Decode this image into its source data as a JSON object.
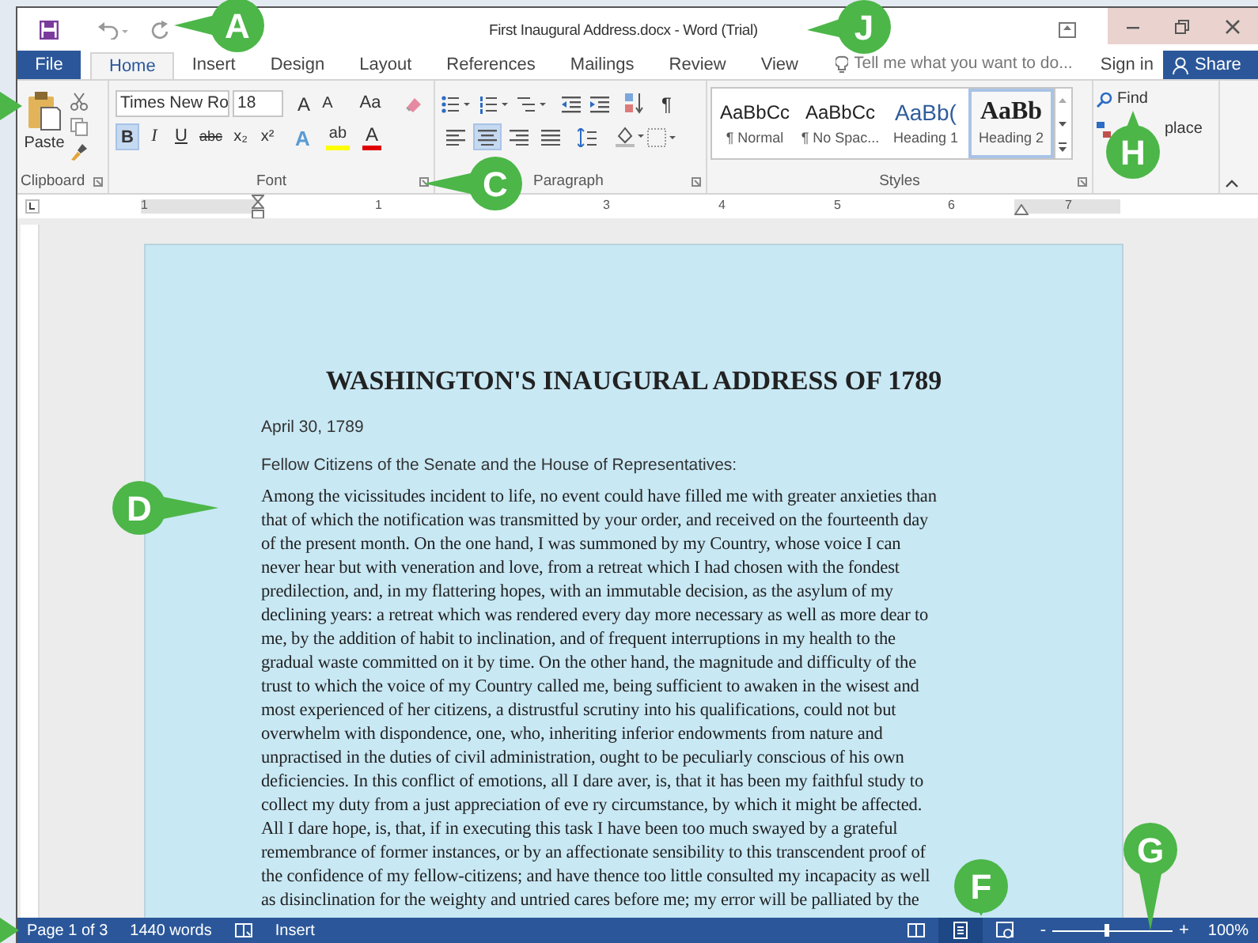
{
  "title_bar": {
    "title": "First Inaugural Address.docx - Word (Trial)"
  },
  "tabs": [
    {
      "label": "File",
      "kind": "file",
      "selected": false
    },
    {
      "label": "Home",
      "kind": "tab",
      "selected": true
    },
    {
      "label": "Insert",
      "kind": "tab",
      "selected": false
    },
    {
      "label": "Design",
      "kind": "tab",
      "selected": false
    },
    {
      "label": "Layout",
      "kind": "tab",
      "selected": false
    },
    {
      "label": "References",
      "kind": "tab",
      "selected": false
    },
    {
      "label": "Mailings",
      "kind": "tab",
      "selected": false
    },
    {
      "label": "Review",
      "kind": "tab",
      "selected": false
    },
    {
      "label": "View",
      "kind": "tab",
      "selected": false
    }
  ],
  "tell_me": {
    "placeholder": "Tell me what you want to do..."
  },
  "account": {
    "sign_in": "Sign in",
    "share": "Share"
  },
  "ribbon": {
    "clipboard": {
      "paste": "Paste",
      "label": "Clipboard"
    },
    "font": {
      "font_name": "Times New Ro",
      "font_size": "18",
      "grow": "A",
      "shrink": "A",
      "change_case": "Aa",
      "label": "Font",
      "format_buttons": [
        {
          "label": "B",
          "kind": "bold",
          "selected": true
        },
        {
          "label": "I",
          "kind": "italic",
          "selected": false
        },
        {
          "label": "U",
          "kind": "underline",
          "selected": false
        },
        {
          "label": "abc",
          "kind": "strike",
          "selected": false
        },
        {
          "label": "x₂",
          "kind": "plain",
          "selected": false
        },
        {
          "label": "x²",
          "kind": "plain",
          "selected": false
        }
      ],
      "effect_buttons": [
        {
          "label": "A",
          "kind": "effects"
        },
        {
          "label": "ab",
          "kind": "highlight",
          "color": "#ffff00"
        },
        {
          "label": "A",
          "kind": "font_color",
          "color": "#e00000"
        }
      ]
    },
    "paragraph": {
      "pilcrow": "¶",
      "label": "Paragraph",
      "alignments": [
        {
          "kind": "left",
          "selected": false
        },
        {
          "kind": "center",
          "selected": true
        },
        {
          "kind": "right",
          "selected": false
        },
        {
          "kind": "justify",
          "selected": false
        }
      ]
    },
    "styles": {
      "label": "Styles",
      "items": [
        {
          "preview": "AaBbCc",
          "name": "¶ Normal",
          "kind": "normal",
          "selected": false
        },
        {
          "preview": "AaBbCc",
          "name": "¶ No Spac...",
          "kind": "normal",
          "selected": false
        },
        {
          "preview": "AaBb(",
          "name": "Heading 1",
          "kind": "heading1",
          "selected": false
        },
        {
          "preview": "AaBb",
          "name": "Heading 2",
          "kind": "heading2",
          "selected": true
        }
      ]
    },
    "editing": {
      "find": "Find",
      "replace": "place"
    }
  },
  "ruler": {
    "marks": [
      "1",
      "1",
      "3",
      "4",
      "5",
      "6",
      "7"
    ]
  },
  "document": {
    "heading": "WASHINGTON'S INAUGURAL ADDRESS OF 1789",
    "date": "April 30, 1789",
    "salutation": "Fellow Citizens of the Senate and the House of Representatives:",
    "body_lines": [
      "Among the vicissitudes incident to life, no event could have filled me with greater anxieties than",
      "that of which the notification was transmitted by your order, and received on the fourteenth day",
      "of the present month. On the one hand, I was summoned by my Country, whose voice I can",
      "never hear but with veneration and love, from a retreat which I had chosen with the fondest",
      "predilection, and, in my flattering hopes, with an immutable decision, as the asylum of my",
      "declining years: a retreat which was rendered every day more necessary as well as more dear to",
      "me, by the addition of habit to inclination, and of frequent interruptions in my health to the",
      "gradual waste committed on it by time. On the other hand, the magnitude and difficulty of the",
      "trust to which the voice of my Country called me, being sufficient to awaken in the wisest and",
      "most experienced of her citizens, a distrustful scrutiny into his qualifications, could not but",
      "overwhelm with dispondence, one, who, inheriting inferior endowments from nature and",
      "unpractised in the duties of civil administration, ought to be peculiarly conscious of his own",
      "deficiencies. In this conflict of emotions, all I dare aver, is, that it has been my faithful study to",
      "collect my duty from a just appreciation of eve ry circumstance, by which it might be affected.",
      "All I dare hope, is, that, if in executing this task I have been too much swayed by a grateful",
      "remembrance of former instances, or by an affectionate sensibility to this transcendent proof of",
      "the confidence of my fellow-citizens; and have thence too little consulted my incapacity as well",
      "as disinclination for the weighty and untried cares before me; my error will be palliated by the"
    ]
  },
  "status_bar": {
    "page": "Page 1 of 3",
    "words": "1440 words",
    "mode": "Insert",
    "views": [
      {
        "kind": "read",
        "selected": false
      },
      {
        "kind": "print",
        "selected": true
      },
      {
        "kind": "web",
        "selected": false
      }
    ],
    "zoom_out": "-",
    "zoom_in": "+",
    "zoom": {
      "level": 0.45,
      "reading": "100%"
    }
  },
  "callouts": [
    {
      "kind": "pointer"
    },
    {
      "kind": "pointer"
    },
    {
      "kind": "badge",
      "label": "A"
    },
    {
      "kind": "badge",
      "label": "J"
    },
    {
      "kind": "badge",
      "label": "H"
    },
    {
      "kind": "badge",
      "label": "C"
    },
    {
      "kind": "badge",
      "label": "D"
    },
    {
      "kind": "badge",
      "label": "F"
    },
    {
      "kind": "badge",
      "label": "G"
    }
  ]
}
